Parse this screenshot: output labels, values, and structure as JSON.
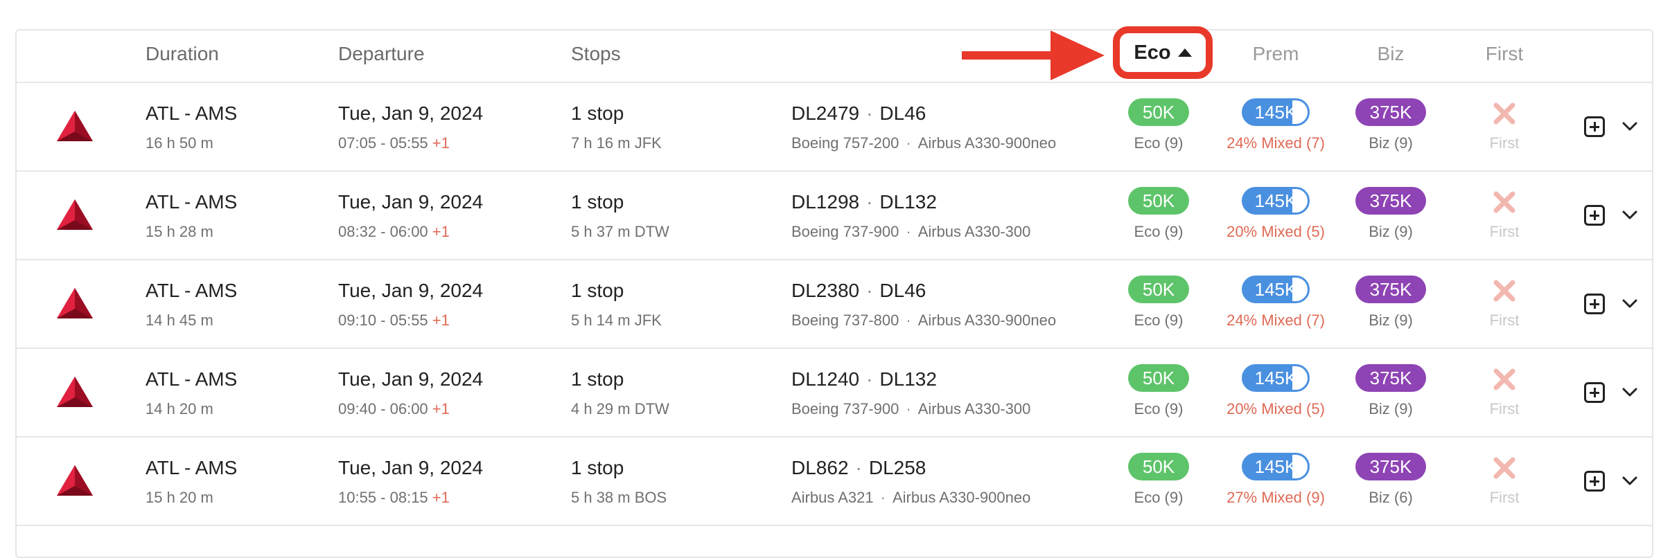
{
  "header": {
    "duration": "Duration",
    "departure": "Departure",
    "stops": "Stops",
    "eco": "Eco",
    "prem": "Prem",
    "biz": "Biz",
    "first": "First"
  },
  "colors": {
    "eco_pill": "#5ec46a",
    "prem_pill": "#4a90e0",
    "biz_pill": "#8e44b4",
    "highlight": "#e8392a",
    "mixed_text": "#e06a55",
    "unavailable": "#f2b8b0"
  },
  "icons": {
    "airline_logo": "delta-logo-icon",
    "unavailable": "x-icon",
    "add": "plus-square-icon",
    "expand": "chevron-down-icon",
    "sort": "caret-up-icon",
    "annotation": "red-arrow"
  },
  "rows": [
    {
      "route": "ATL - AMS",
      "duration": "16 h 50 m",
      "date": "Tue, Jan 9, 2024",
      "times": "07:05 - 05:55",
      "day_offset": "+1",
      "stops": "1 stop",
      "layover": "7 h 16 m  JFK",
      "flight1": "DL2479",
      "flight2": "DL46",
      "aircraft1": "Boeing 757-200",
      "aircraft2": "Airbus A330-900neo",
      "eco_price": "50K",
      "eco_label": "Eco (9)",
      "prem_price": "145K",
      "prem_label": "24% Mixed (7)",
      "biz_price": "375K",
      "biz_label": "Biz (9)",
      "first_label": "First"
    },
    {
      "route": "ATL - AMS",
      "duration": "15 h 28 m",
      "date": "Tue, Jan 9, 2024",
      "times": "08:32 - 06:00",
      "day_offset": "+1",
      "stops": "1 stop",
      "layover": "5 h 37 m  DTW",
      "flight1": "DL1298",
      "flight2": "DL132",
      "aircraft1": "Boeing 737-900",
      "aircraft2": "Airbus A330-300",
      "eco_price": "50K",
      "eco_label": "Eco (9)",
      "prem_price": "145K",
      "prem_label": "20% Mixed (5)",
      "biz_price": "375K",
      "biz_label": "Biz (9)",
      "first_label": "First"
    },
    {
      "route": "ATL - AMS",
      "duration": "14 h 45 m",
      "date": "Tue, Jan 9, 2024",
      "times": "09:10 - 05:55",
      "day_offset": "+1",
      "stops": "1 stop",
      "layover": "5 h 14 m  JFK",
      "flight1": "DL2380",
      "flight2": "DL46",
      "aircraft1": "Boeing 737-800",
      "aircraft2": "Airbus A330-900neo",
      "eco_price": "50K",
      "eco_label": "Eco (9)",
      "prem_price": "145K",
      "prem_label": "24% Mixed (7)",
      "biz_price": "375K",
      "biz_label": "Biz (9)",
      "first_label": "First"
    },
    {
      "route": "ATL - AMS",
      "duration": "14 h 20 m",
      "date": "Tue, Jan 9, 2024",
      "times": "09:40 - 06:00",
      "day_offset": "+1",
      "stops": "1 stop",
      "layover": "4 h 29 m  DTW",
      "flight1": "DL1240",
      "flight2": "DL132",
      "aircraft1": "Boeing 737-900",
      "aircraft2": "Airbus A330-300",
      "eco_price": "50K",
      "eco_label": "Eco (9)",
      "prem_price": "145K",
      "prem_label": "20% Mixed (5)",
      "biz_price": "375K",
      "biz_label": "Biz (9)",
      "first_label": "First"
    },
    {
      "route": "ATL - AMS",
      "duration": "15 h 20 m",
      "date": "Tue, Jan 9, 2024",
      "times": "10:55 - 08:15",
      "day_offset": "+1",
      "stops": "1 stop",
      "layover": "5 h 38 m  BOS",
      "flight1": "DL862",
      "flight2": "DL258",
      "aircraft1": "Airbus A321",
      "aircraft2": "Airbus A330-900neo",
      "eco_price": "50K",
      "eco_label": "Eco (9)",
      "prem_price": "145K",
      "prem_label": "27% Mixed (9)",
      "biz_price": "375K",
      "biz_label": "Biz (6)",
      "first_label": "First"
    }
  ]
}
